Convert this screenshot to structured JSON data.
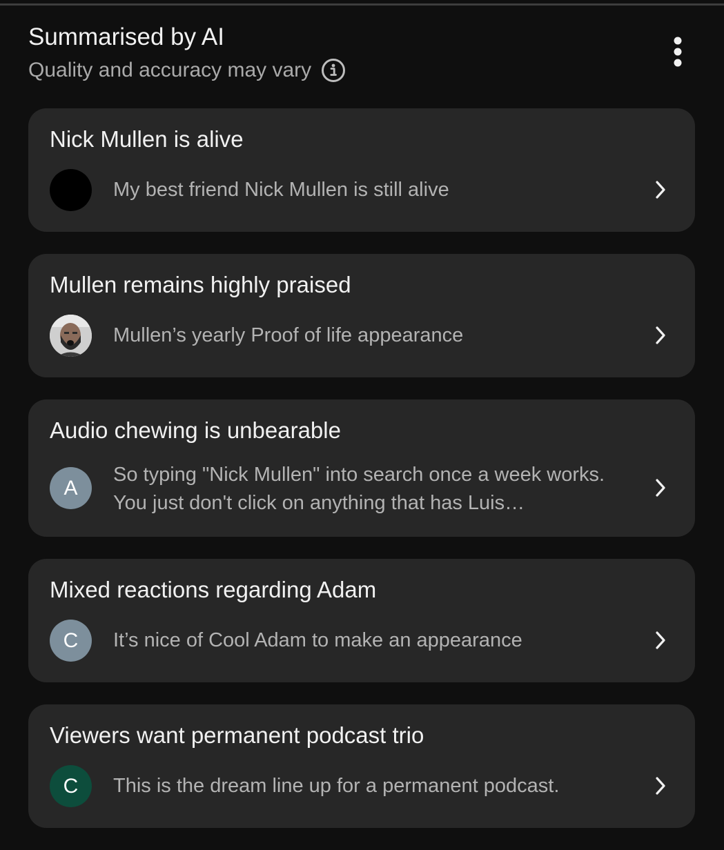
{
  "header": {
    "title": "Summarised by AI",
    "subtitle": "Quality and accuracy may vary",
    "info_icon": "info-circle-icon",
    "more_icon": "more-vertical-icon"
  },
  "colors": {
    "background": "#0f0f0f",
    "card": "#272727",
    "title_text": "#f1f1f1",
    "secondary_text": "#aaaaaa",
    "avatar_gray": "#7d8f9c",
    "avatar_green": "#0d4d3c"
  },
  "cards": [
    {
      "title": "Nick Mullen is alive",
      "snippet": "My best friend Nick Mullen is still alive",
      "avatar": {
        "type": "image",
        "icon": "black-circle-avatar",
        "letter": ""
      }
    },
    {
      "title": "Mullen remains highly praised",
      "snippet": "Mullen’s yearly Proof of life appearance",
      "avatar": {
        "type": "image",
        "icon": "bearded-man-photo-avatar",
        "letter": ""
      }
    },
    {
      "title": "Audio chewing is unbearable",
      "snippet": "So typing \"Nick Mullen\" into search once a week works. You just don't click on anything that has Luis…",
      "avatar": {
        "type": "letter",
        "icon": "letter-avatar",
        "letter": "A"
      }
    },
    {
      "title": "Mixed reactions regarding Adam",
      "snippet": "It’s nice of Cool Adam to make an appearance",
      "avatar": {
        "type": "letter",
        "icon": "letter-avatar",
        "letter": "C"
      }
    },
    {
      "title": "Viewers want permanent podcast trio",
      "snippet": "This is the dream line up for a permanent podcast.",
      "avatar": {
        "type": "letter",
        "icon": "letter-avatar",
        "letter": "C"
      }
    }
  ]
}
